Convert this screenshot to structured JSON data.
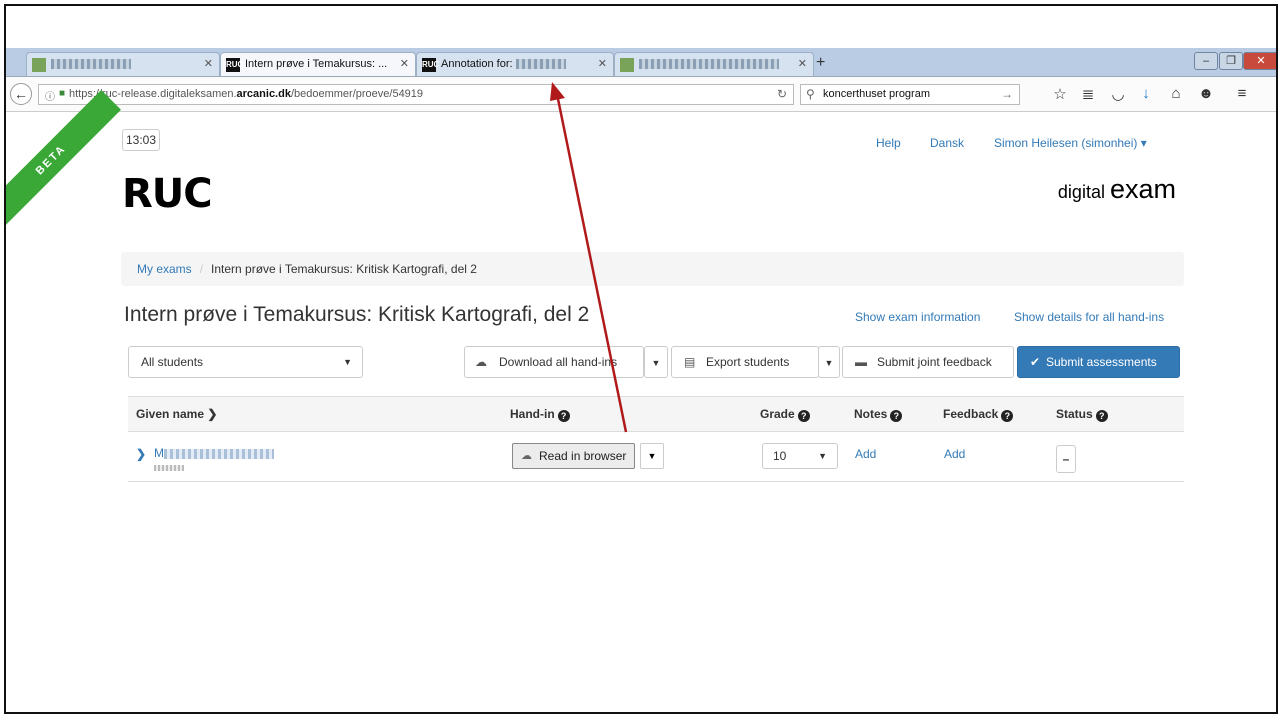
{
  "browser": {
    "tabs": [
      {
        "label": "",
        "blurred": true
      },
      {
        "label": "Intern prøve i Temakursus: ...",
        "blurred": false
      },
      {
        "label": "Annotation for:",
        "blurred": false
      },
      {
        "label": "",
        "blurred": true
      }
    ],
    "url_prefix": "https://ruc-release.digitaleksamen.",
    "url_domain": "arcanic.dk",
    "url_path": "/bedoemmer/proeve/54919",
    "search_value": "koncerthuset program"
  },
  "page": {
    "beta_label": "BETA",
    "clock": "13:03",
    "logo": "RUC",
    "top_links": {
      "help": "Help",
      "language": "Dansk",
      "user": "Simon Heilesen (simonhei) ▾"
    },
    "brand_small": "digital",
    "brand_big": "exam",
    "breadcrumb": {
      "root": "My exams",
      "separator": "/",
      "current": "Intern prøve i Temakursus: Kritisk Kartografi, del 2"
    },
    "title": "Intern prøve i Temakursus: Kritisk Kartografi, del 2",
    "links": {
      "exam_info": "Show exam information",
      "details_all": "Show details for all hand-ins"
    },
    "filter_value": "All students",
    "buttons": {
      "download": "Download all hand-ins",
      "export": "Export students",
      "joint_feedback": "Submit joint feedback",
      "submit": "Submit assessments"
    },
    "table": {
      "headers": {
        "given_name": "Given name",
        "hand_in": "Hand-in",
        "grade": "Grade",
        "notes": "Notes",
        "feedback": "Feedback",
        "status": "Status"
      },
      "row": {
        "name_prefix": "M",
        "read_btn": "Read in browser",
        "grade": "10",
        "notes": "Add",
        "feedback": "Add",
        "status": "–"
      }
    }
  },
  "colors": {
    "accent": "#337ab7",
    "beta": "#3aa836",
    "annotation_arrow": "#b11a1a"
  }
}
